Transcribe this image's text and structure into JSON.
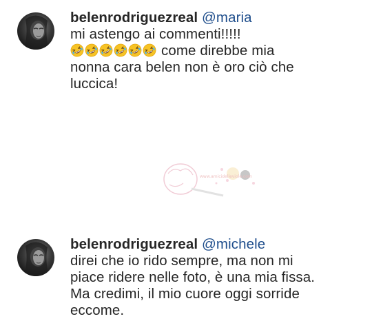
{
  "comments": [
    {
      "username": "belenrodriguezreal",
      "mention": "@maria",
      "line1": "mi astengo ai commenti!!!!!",
      "emoji_count": 6,
      "emoji_icon": "rofl-laughing-emoji-icon",
      "line2_text": "come direbbe mia",
      "line3": "nonna cara belen non è oro ciò che",
      "line4": "luccica!"
    },
    {
      "username": "belenrodriguezreal",
      "mention": "@michele",
      "line1": "direi che io rido sempre, ma non mi",
      "line2": "piace ridere nelle foto, è una mia fissa.",
      "line3": "Ma credimi, il mio cuore oggi sorride",
      "line4": "eccome."
    }
  ],
  "watermark": {
    "site_text": "www.amicidelleviole.com"
  },
  "colors": {
    "username": "#262626",
    "mention": "#1f4e8c",
    "text": "#262626",
    "background": "#ffffff"
  }
}
